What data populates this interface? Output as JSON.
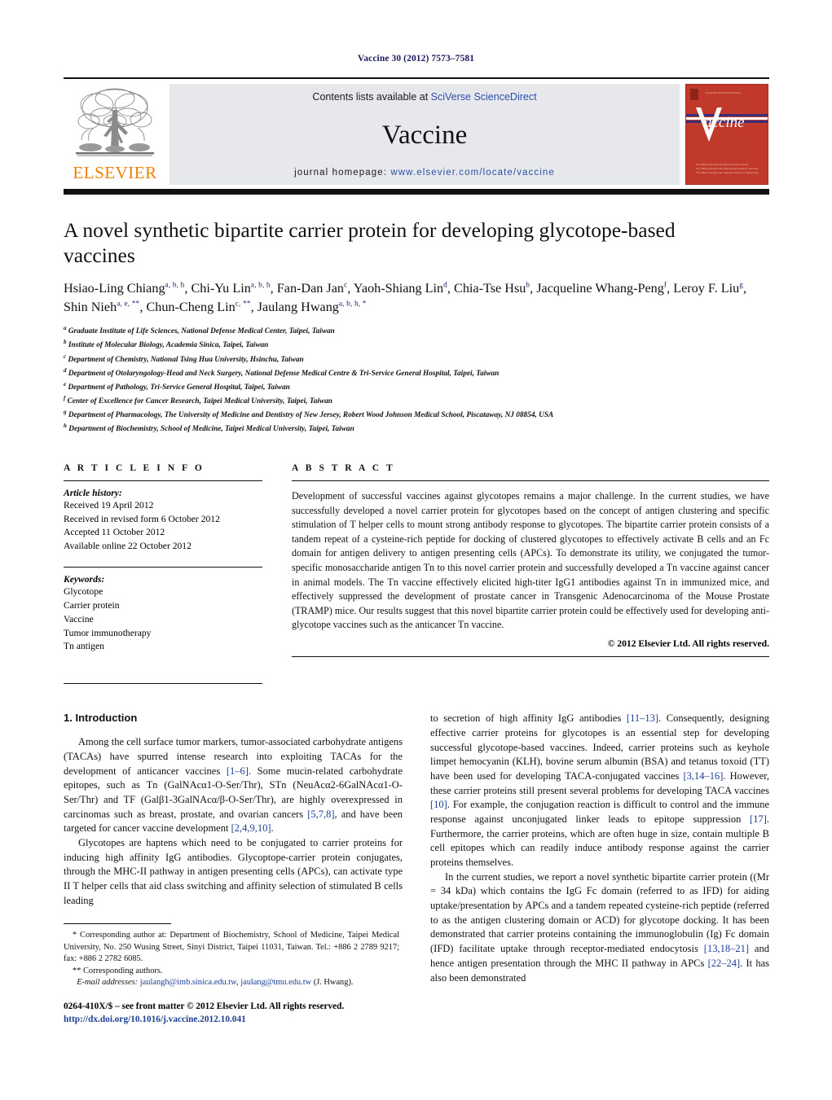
{
  "running_head": "Vaccine 30 (2012) 7573–7581",
  "masthead": {
    "publisher_logo_text": "ELSEVIER",
    "contents_prefix": "Contents lists available at ",
    "contents_link": "SciVerse ScienceDirect",
    "journal_name": "Vaccine",
    "homepage_prefix": "journal homepage: ",
    "homepage_url": "www.elsevier.com/locate/vaccine",
    "cover_title": "Vaccine",
    "cover_top_text": "THE OFFICIAL JOURNAL OF",
    "cover_bottom_line1": "The Official Journal of The Edward Jenner Society",
    "cover_bottom_line2": "The Official Journal of the International Society for Vaccines",
    "cover_bottom_line3": "The Official Journal of the Japanese Society for Vaccinology",
    "accent_orange": "#f08000",
    "link_blue": "#2b50a8",
    "cover_red": "#c0392b",
    "panel_gray": "#e7e8ec"
  },
  "title": "A novel synthetic bipartite carrier protein for developing glycotope-based vaccines",
  "authors": [
    {
      "name": "Hsiao-Ling Chiang",
      "sup": "a, b, h"
    },
    {
      "name": "Chi-Yu Lin",
      "sup": "a, b, h"
    },
    {
      "name": "Fan-Dan Jan",
      "sup": "c"
    },
    {
      "name": "Yaoh-Shiang Lin",
      "sup": "d"
    },
    {
      "name": "Chia-Tse Hsu",
      "sup": "b"
    },
    {
      "name": "Jacqueline Whang-Peng",
      "sup": "f"
    },
    {
      "name": "Leroy F. Liu",
      "sup": "g"
    },
    {
      "name": "Shin Nieh",
      "sup": "a, e, **"
    },
    {
      "name": "Chun-Cheng Lin",
      "sup": "c, **"
    },
    {
      "name": "Jaulang Hwang",
      "sup": "a, b, h, *"
    }
  ],
  "affiliations": [
    {
      "mark": "a",
      "text": "Graduate Institute of Life Sciences, National Defense Medical Center, Taipei, Taiwan"
    },
    {
      "mark": "b",
      "text": "Institute of Molecular Biology, Academia Sinica, Taipei, Taiwan"
    },
    {
      "mark": "c",
      "text": "Department of Chemistry, National Tsing Hua University, Hsinchu, Taiwan"
    },
    {
      "mark": "d",
      "text": "Department of Otolaryngology-Head and Neck Surgery, National Defense Medical Centre & Tri-Service General Hospital, Taipei, Taiwan"
    },
    {
      "mark": "e",
      "text": "Department of Pathology, Tri-Service General Hospital, Taipei, Taiwan"
    },
    {
      "mark": "f",
      "text": "Center of Excellence for Cancer Research, Taipei Medical University, Taipei, Taiwan"
    },
    {
      "mark": "g",
      "text": "Department of Pharmacology, The University of Medicine and Dentistry of New Jersey, Robert Wood Johnson Medical School, Piscataway, NJ 08854, USA"
    },
    {
      "mark": "h",
      "text": "Department of Biochemistry, School of Medicine, Taipei Medical University, Taipei, Taiwan"
    }
  ],
  "article_info": {
    "heading": "A R T I C L E   I N F O",
    "history_label": "Article history:",
    "history": [
      "Received 19 April 2012",
      "Received in revised form 6 October 2012",
      "Accepted 11 October 2012",
      "Available online 22 October 2012"
    ],
    "keywords_label": "Keywords:",
    "keywords": [
      "Glycotope",
      "Carrier protein",
      "Vaccine",
      "Tumor immunotherapy",
      "Tn antigen"
    ]
  },
  "abstract": {
    "heading": "A B S T R A C T",
    "text": "Development of successful vaccines against glycotopes remains a major challenge. In the current studies, we have successfully developed a novel carrier protein for glycotopes based on the concept of antigen clustering and specific stimulation of T helper cells to mount strong antibody response to glycotopes. The bipartite carrier protein consists of a tandem repeat of a cysteine-rich peptide for docking of clustered glycotopes to effectively activate B cells and an Fc domain for antigen delivery to antigen presenting cells (APCs). To demonstrate its utility, we conjugated the tumor-specific monosaccharide antigen Tn to this novel carrier protein and successfully developed a Tn vaccine against cancer in animal models. The Tn vaccine effectively elicited high-titer IgG1 antibodies against Tn in immunized mice, and effectively suppressed the development of prostate cancer in Transgenic Adenocarcinoma of the Mouse Prostate (TRAMP) mice. Our results suggest that this novel bipartite carrier protein could be effectively used for developing anti-glycotope vaccines such as the anticancer Tn vaccine.",
    "copyright": "© 2012 Elsevier Ltd. All rights reserved."
  },
  "introduction": {
    "heading": "1. Introduction",
    "left_p1_a": "Among the cell surface tumor markers, tumor-associated carbohydrate antigens (TACAs) have spurred intense research into exploiting TACAs for the development of anticancer vaccines ",
    "left_p1_r1": "[1–6]",
    "left_p1_b": ". Some mucin-related carbohydrate epitopes, such as Tn (GalNAcα1-O-Ser/Thr), STn (NeuAcα2-6GalNAcα1-O-Ser/Thr) and TF (Galβ1-3GalNAcα/β-O-Ser/Thr), are highly overexpressed in carcinomas such as breast, prostate, and ovarian cancers ",
    "left_p1_r2": "[5,7,8]",
    "left_p1_c": ", and have been targeted for cancer vaccine development ",
    "left_p1_r3": "[2,4,9,10]",
    "left_p1_d": ".",
    "left_p2": "Glycotopes are haptens which need to be conjugated to carrier proteins for inducing high affinity IgG antibodies. Glycoptope-carrier protein conjugates, through the MHC-II pathway in antigen presenting cells (APCs), can activate type II T helper cells that aid class switching and affinity selection of stimulated B cells leading",
    "right_p1_a": "to secretion of high affinity IgG antibodies ",
    "right_p1_r1": "[11–13]",
    "right_p1_b": ". Consequently, designing effective carrier proteins for glycotopes is an essential step for developing successful glycotope-based vaccines. Indeed, carrier proteins such as keyhole limpet hemocyanin (KLH), bovine serum albumin (BSA) and tetanus toxoid (TT) have been used for developing TACA-conjugated vaccines ",
    "right_p1_r2": "[3,14–16]",
    "right_p1_c": ". However, these carrier proteins still present several problems for developing TACA vaccines ",
    "right_p1_r3": "[10]",
    "right_p1_d": ". For example, the conjugation reaction is difficult to control and the immune response against unconjugated linker leads to epitope suppression ",
    "right_p1_r4": "[17]",
    "right_p1_e": ". Furthermore, the carrier proteins, which are often huge in size, contain multiple B cell epitopes which can readily induce antibody response against the carrier proteins themselves.",
    "right_p2_a": "In the current studies, we report a novel synthetic bipartite carrier protein ((Mr = 34 kDa) which contains the IgG Fc domain (referred to as IFD) for aiding uptake/presentation by APCs and a tandem repeated cysteine-rich peptide (referred to as the antigen clustering domain or ACD) for glycotope docking. It has been demonstrated that carrier proteins containing the immunoglobulin (Ig) Fc domain (IFD) facilitate uptake through receptor-mediated endocytosis ",
    "right_p2_r1": "[13,18–21]",
    "right_p2_b": " and hence antigen presentation through the MHC II pathway in APCs ",
    "right_p2_r2": "[22–24]",
    "right_p2_c": ". It has also been demonstrated"
  },
  "footnotes": {
    "corresponding_1": "* Corresponding author at: Department of Biochemistry, School of Medicine, Taipei Medical University, No. 250 Wusing Street, Sinyi District, Taipei 11031, Taiwan. Tel.: +886 2 2789 9217; fax: +886 2 2782 6085.",
    "corresponding_2": "** Corresponding authors.",
    "email_label": "E-mail addresses:",
    "email_1": "jaulangh@imb.sinica.edu.tw",
    "email_2": "jaulang@tmu.edu.tw",
    "email_attrib": "(J. Hwang)."
  },
  "footer": {
    "issn": "0264-410X/$ – see front matter © 2012 Elsevier Ltd. All rights reserved.",
    "doi": "http://dx.doi.org/10.1016/j.vaccine.2012.10.041"
  }
}
